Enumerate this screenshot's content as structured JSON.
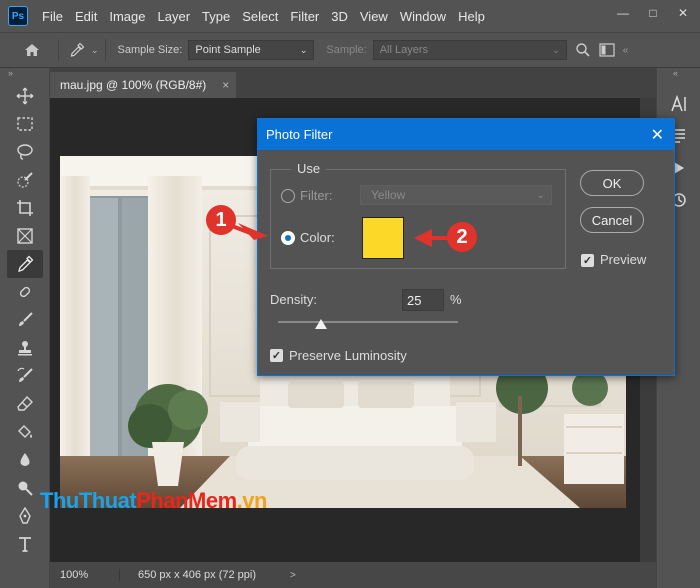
{
  "app": {
    "logo": "Ps",
    "menu": [
      "File",
      "Edit",
      "Image",
      "Layer",
      "Type",
      "Select",
      "Filter",
      "3D",
      "View",
      "Window",
      "Help"
    ],
    "window_controls": {
      "minimize": "—",
      "maximize": "□",
      "close": "✕"
    }
  },
  "options_bar": {
    "sample_size_label": "Sample Size:",
    "sample_size_value": "Point Sample",
    "sample_label": "Sample:",
    "sample_value": "All Layers"
  },
  "document": {
    "tab_title": "mau.jpg @ 100% (RGB/8#)",
    "tab_close": "×",
    "zoom": "100%",
    "dimensions": "650 px x 406 px (72 ppi)",
    "status_arrow": ">"
  },
  "watermark": {
    "part1": "Thu",
    "part2": "Thuat",
    "part3": "Phan",
    "part4": "Mem",
    "part5": ".vn"
  },
  "dialog": {
    "title": "Photo Filter",
    "close": "✕",
    "use_group_label": "Use",
    "filter_label": "Filter:",
    "filter_value": "Yellow",
    "color_label": "Color:",
    "color_swatch": "#fcd928",
    "selected_option": "Color",
    "ok_label": "OK",
    "cancel_label": "Cancel",
    "preview_label": "Preview",
    "preview_checked": true,
    "density_label": "Density:",
    "density_value": "25",
    "density_unit": "%",
    "preserve_label": "Preserve Luminosity",
    "preserve_checked": true
  },
  "annotations": {
    "marker_1": "1",
    "marker_2": "2",
    "color_hex": "#e0332b"
  },
  "icons": [
    "home-icon",
    "eyedropper-icon",
    "search-icon",
    "move-icon",
    "marquee-icon",
    "lasso-icon",
    "quick-select-icon",
    "crop-icon",
    "frame-icon",
    "brush-icon",
    "stamp-icon",
    "eraser-icon",
    "pen-icon",
    "type-icon"
  ]
}
